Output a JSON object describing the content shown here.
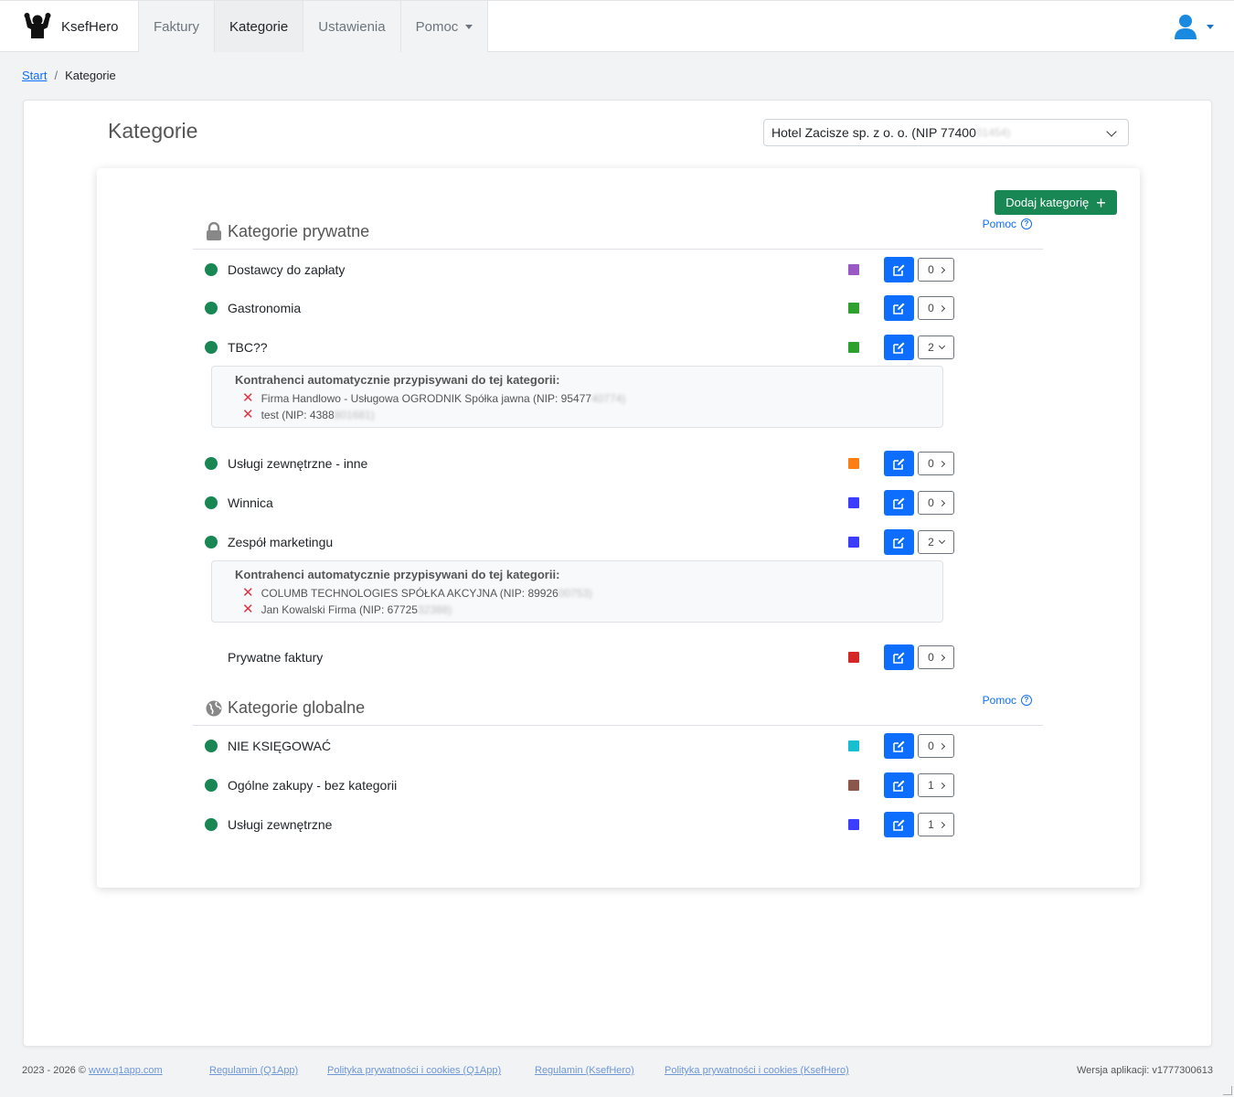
{
  "app": {
    "name": "KsefHero"
  },
  "nav": {
    "tabs": [
      {
        "label": "Faktury"
      },
      {
        "label": "Kategorie"
      },
      {
        "label": "Ustawienia"
      },
      {
        "label": "Pomoc"
      }
    ]
  },
  "breadcrumb": {
    "start": "Start",
    "separator": "/",
    "current": "Kategorie"
  },
  "page": {
    "title": "Kategorie",
    "company": {
      "visible": "Hotel Zacisze sp. z o. o. (NIP 77400",
      "masked": "01454)"
    }
  },
  "add_button": "Dodaj kategorię",
  "private_section": {
    "title": "Kategorie prywatne",
    "help": "Pomoc",
    "contractors_header": "Kontrahenci automatycznie przypisywani do tej kategorii:",
    "rows": [
      {
        "name": "Dostawcy do zapłaty",
        "color": "#9b59c6",
        "count": "0"
      },
      {
        "name": "Gastronomia",
        "color": "#2ea02e",
        "count": "0"
      },
      {
        "name": "TBC??",
        "color": "#2ea02e",
        "count": "2",
        "contractors": [
          {
            "visible": "Firma Handlowo - Usługowa OGRODNIK Spółka jawna (NIP: 95477",
            "masked": "40774)"
          },
          {
            "visible": "test (NIP: 4388",
            "masked": "801681)"
          }
        ]
      },
      {
        "name": "Usługi zewnętrzne - inne",
        "color": "#fd7e14",
        "count": "0"
      },
      {
        "name": "Winnica",
        "color": "#3d3dff",
        "count": "0"
      },
      {
        "name": "Zespół marketingu",
        "color": "#3d3dff",
        "count": "2",
        "contractors": [
          {
            "visible": "COLUMB TECHNOLOGIES SPÓŁKA AKCYJNA (NIP: 89926",
            "masked": "00753)"
          },
          {
            "visible": "Jan Kowalski Firma (NIP: 67725",
            "masked": "32388)"
          }
        ]
      },
      {
        "name": "Prywatne faktury",
        "color": "#d62728",
        "count": "0"
      }
    ]
  },
  "global_section": {
    "title": "Kategorie globalne",
    "help": "Pomoc",
    "rows": [
      {
        "name": "NIE KSIĘGOWAĆ",
        "color": "#17becf",
        "count": "0"
      },
      {
        "name": "Ogólne zakupy - bez kategorii",
        "color": "#8c564b",
        "count": "1"
      },
      {
        "name": "Usługi zewnętrzne",
        "color": "#3d3dff",
        "count": "1"
      }
    ]
  },
  "footer": {
    "copyright": "2023 - 2026 ©",
    "site_link": "www.q1app.com",
    "links": [
      "Regulamin (Q1App)",
      "Polityka prywatności i cookies (Q1App)",
      "Regulamin (KsefHero)",
      "Polityka prywatności i cookies (KsefHero)"
    ],
    "version": "Wersja aplikacji: v1777300613"
  }
}
